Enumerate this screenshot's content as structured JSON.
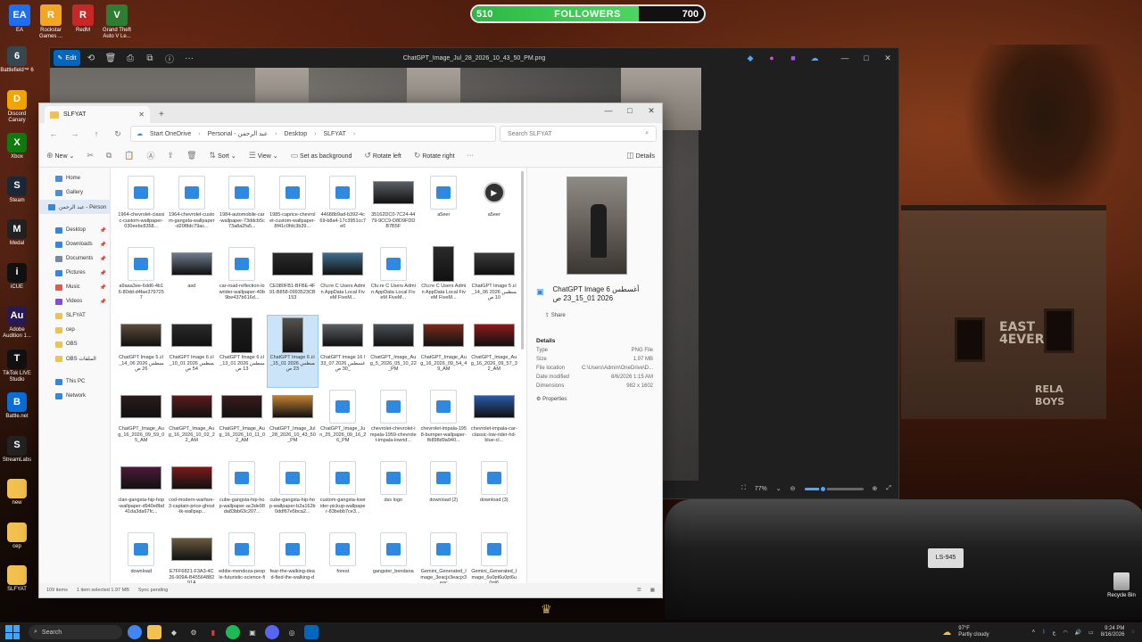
{
  "followers": {
    "left": "510",
    "label": "FOLLOWERS",
    "right": "700",
    "progress": 0.72
  },
  "desktop_top": [
    {
      "label": "EA",
      "color": "#1f6ef0",
      "glyph": "EA"
    },
    {
      "label": "Rockstar Games ...",
      "color": "#f3a623",
      "glyph": "R"
    },
    {
      "label": "RedM",
      "color": "#c62828",
      "glyph": "R"
    },
    {
      "label": "Grand Theft Auto V Le...",
      "color": "#2e7d32",
      "glyph": "V"
    }
  ],
  "desktop_left": [
    {
      "label": "Battlefield™ 6",
      "color": "#37474f",
      "glyph": "6"
    },
    {
      "label": "Discord Canary",
      "color": "#f0a500",
      "glyph": "D"
    },
    {
      "label": "Xbox",
      "color": "#107c10",
      "glyph": "X"
    },
    {
      "label": "Steam",
      "color": "#1b2838",
      "glyph": "S"
    },
    {
      "label": "Medal",
      "color": "#222",
      "glyph": "M"
    },
    {
      "label": "iCUE",
      "color": "#111",
      "glyph": "i"
    },
    {
      "label": "Adobe Audition 1...",
      "color": "#2a1a52",
      "glyph": "Au"
    },
    {
      "label": "TikTok LIVE Studio",
      "color": "#111",
      "glyph": "T"
    },
    {
      "label": "Battle.net",
      "color": "#0b6ed8",
      "glyph": "B"
    },
    {
      "label": "StreamLabs",
      "color": "#222",
      "glyph": "S"
    },
    {
      "label": "new",
      "color": "#f2c14e",
      "glyph": ""
    },
    {
      "label": "cep",
      "color": "#f2c14e",
      "glyph": ""
    },
    {
      "label": "SLFYAT",
      "color": "#f2c14e",
      "glyph": ""
    }
  ],
  "recycle_bin": "Recycle Bin",
  "viewer": {
    "title": "ChatGPT_Image_Jul_28_2026_10_43_50_PM.png",
    "edit_label": "Edit",
    "zoom": "77%"
  },
  "explorer": {
    "tab_title": "SLFYAT",
    "breadcrumb": [
      "Start OneDrive",
      "Personal - عبد الرحمن",
      "Desktop",
      "SLFYAT"
    ],
    "search_placeholder": "Search SLFYAT",
    "toolbar": {
      "new": "New",
      "sort": "Sort",
      "view": "View",
      "set_bg": "Set as background",
      "rotate_left": "Rotate left",
      "rotate_right": "Rotate right",
      "more": "···",
      "details": "Details"
    },
    "nav": [
      {
        "label": "Home",
        "color": "#4a90d9"
      },
      {
        "label": "Gallery",
        "color": "#4a90d9"
      },
      {
        "label": "عبد الرحمن - Person",
        "color": "#2f89e0",
        "sel": true
      },
      {
        "gap": true
      },
      {
        "label": "Desktop",
        "color": "#2f89e0",
        "pin": true
      },
      {
        "label": "Downloads",
        "color": "#2f89e0",
        "pin": true
      },
      {
        "label": "Documents",
        "color": "#7a8a9c",
        "pin": true
      },
      {
        "label": "Pictures",
        "color": "#2f89e0",
        "pin": true
      },
      {
        "label": "Music",
        "color": "#e05c4a",
        "pin": true
      },
      {
        "label": "Videos",
        "color": "#8a4ad9",
        "pin": true
      },
      {
        "label": "SLFYAT",
        "color": "#f2c14e"
      },
      {
        "label": "cep",
        "color": "#f2c14e"
      },
      {
        "label": "OBS",
        "color": "#f2c14e"
      },
      {
        "label": "OBS الملفات",
        "color": "#f2c14e"
      },
      {
        "gap": true
      },
      {
        "label": "This PC",
        "color": "#2f89e0"
      },
      {
        "label": "Network",
        "color": "#2f89e0"
      }
    ],
    "files": [
      {
        "name": "1964-chevrolet-classic-custom-wallpaper-030eebc8358...",
        "kind": "doc"
      },
      {
        "name": "1964-chevrolet-custom-gangsta-wallpaper-d20f8dc79ac...",
        "kind": "doc"
      },
      {
        "name": "1984-automobile-car-wallpaper-73ddcb5c73a8a2fa5...",
        "kind": "doc"
      },
      {
        "name": "1985-caprice-chevrolet-custom-wallpaper-8f41c0fdc3b39...",
        "kind": "doc"
      },
      {
        "name": "44688b9ad-b392-4c69-b8a4-17c3951cc7e0",
        "kind": "doc"
      },
      {
        "name": "35162DC0-7C24-4479-9CC9-D8D9FDDB7B5F",
        "kind": "img",
        "color": "#5a5f66"
      },
      {
        "name": "a5eer",
        "kind": "doc"
      },
      {
        "name": "a5eer",
        "kind": "play"
      },
      {
        "name": "a9aaa3ee-6dd6-4b16-80dd-d4fae3797257",
        "kind": "doc"
      },
      {
        "name": "asd",
        "kind": "img",
        "color": "#6e7b8c"
      },
      {
        "name": "car-road-reflection-lowrider-wallpaper-40b9be437b616d...",
        "kind": "doc"
      },
      {
        "name": "CE080FB1-BFBE-4F91-B858-0993523CB153",
        "kind": "img",
        "color": "#2b2b2b"
      },
      {
        "name": "Cfu:re C Users Admin AppData Local FiveM FiveM...",
        "kind": "img",
        "color": "#3f6e8c"
      },
      {
        "name": "Cfu:re C Users Admin AppData Local FiveM FiveM...",
        "kind": "doc"
      },
      {
        "name": "Cfu:re C Users Admin AppData Local FiveM FiveM...",
        "kind": "tall",
        "color": "#2a2a2a"
      },
      {
        "name": "ChatGPT Image 5 أغسطس 2026 06_14_10 ص",
        "kind": "img",
        "color": "#3a3a3a"
      },
      {
        "name": "ChatGPT Image 5 أغسطس 2026 06_14_26 ص",
        "kind": "img",
        "color": "#5c4a3a"
      },
      {
        "name": "ChatGPT Image 6 أغسطس 2026 01_10_54 ص",
        "kind": "img",
        "color": "#2b2b2b"
      },
      {
        "name": "ChatGPT Image 6 أغسطس 2026 01_13_13 ص",
        "kind": "tall",
        "color": "#1e1e1e"
      },
      {
        "name": "ChatGPT Image 6 أغسطس 2026 01_15_23 ص",
        "kind": "tall",
        "color": "#55524e",
        "sel": true
      },
      {
        "name": "ChatGPT Image 16 أغسطس 2026 07_33_30 ص",
        "kind": "img",
        "color": "#5a5e62"
      },
      {
        "name": "ChatGPT_Image_Aug_5_2026_05_10_22_PM",
        "kind": "img",
        "color": "#4a4f55"
      },
      {
        "name": "ChatGPT_Image_Aug_16_2026_09_54_49_AM",
        "kind": "img",
        "color": "#7a2a1a"
      },
      {
        "name": "ChatGPT_Image_Aug_16_2026_09_57_32_AM",
        "kind": "img",
        "color": "#8a1a1a"
      },
      {
        "name": "ChatGPT_Image_Aug_16_2026_09_59_05_AM",
        "kind": "img",
        "color": "#2a1a1a"
      },
      {
        "name": "ChatGPT_Image_Aug_16_2026_10_02_22_AM",
        "kind": "img",
        "color": "#5a1a1a"
      },
      {
        "name": "ChatGPT_Image_Aug_16_2026_10_11_02_AM",
        "kind": "img",
        "color": "#3a1a1a"
      },
      {
        "name": "ChatGPT_Image_Jul_28_2026_10_43_50_PM",
        "kind": "img",
        "color": "#c08030"
      },
      {
        "name": "ChatGPT_Image_Jun_25_2026_09_16_26_PM",
        "kind": "doc"
      },
      {
        "name": "chevrolet-chevrolet-impala-1959-chevrolet-impala-lowrid...",
        "kind": "doc"
      },
      {
        "name": "chevrolet-impala-1958-burnper-wallpaper-fb898d9a940...",
        "kind": "doc"
      },
      {
        "name": "chevrolet-impala-car-classic-low-rider-hd-blue-cl...",
        "kind": "img",
        "color": "#2a5aa8"
      },
      {
        "name": "clan-gangsta-hip-hop-wallpaper-d940e8bd41da3da67fc...",
        "kind": "img",
        "color": "#4a1a3a"
      },
      {
        "name": "cod-modern-warfare-3-captain-price-ghost-tk-wallpap...",
        "kind": "img",
        "color": "#7a1a1a"
      },
      {
        "name": "cube-gangsta-hip-hop-wallpaper-ac3de98da83bb63c207...",
        "kind": "doc"
      },
      {
        "name": "cube-gangsta-hip-hop-wallpaper-b2a162b0ddf67e5bca2...",
        "kind": "doc"
      },
      {
        "name": "custom-gangsta-lowrider-pickup-wallpaper-83bebb7ce3...",
        "kind": "doc"
      },
      {
        "name": "dss logo",
        "kind": "doc"
      },
      {
        "name": "download (2)",
        "kind": "doc"
      },
      {
        "name": "download (3)",
        "kind": "doc"
      },
      {
        "name": "download",
        "kind": "doc"
      },
      {
        "name": "E7FF6821-F3A3-4C26-909A-B4556488291A",
        "kind": "img",
        "color": "#6a5a40"
      },
      {
        "name": "eddie-mendoza-people-futuristic-science-fi",
        "kind": "doc"
      },
      {
        "name": "fear-the-walking-dead-fted-the-walking-d",
        "kind": "doc"
      },
      {
        "name": "forest",
        "kind": "doc"
      },
      {
        "name": "gangster_bendana",
        "kind": "doc"
      },
      {
        "name": "Gemini_Generated_Image_3eacjx3eacjx3eac",
        "kind": "doc"
      },
      {
        "name": "Gemini_Generated_Image_6u0pt6u0pt6u0pt6",
        "kind": "doc"
      }
    ],
    "details": {
      "filename": "ChatGPT Image 6 أغسطس 2026 01_15_23 ص",
      "share": "Share",
      "heading": "Details",
      "rows": [
        {
          "k": "Type",
          "v": "PNG File"
        },
        {
          "k": "Size",
          "v": "1.97 MB"
        },
        {
          "k": "File location",
          "v": "C:\\Users\\Admin\\OneDrive\\D..."
        },
        {
          "k": "Date modified",
          "v": "8/6/2026 1:15 AM"
        },
        {
          "k": "Dimensions",
          "v": "982 x 1602"
        }
      ],
      "properties": "Properties"
    },
    "status": {
      "count": "109 items",
      "selected": "1 item selected  1.97 MB",
      "sync": "Sync pending"
    }
  },
  "taskbar": {
    "search": "Search",
    "weather_temp": "97°F",
    "weather_desc": "Partly cloudy",
    "time": "9:24 PM",
    "date": "8/16/2026"
  }
}
